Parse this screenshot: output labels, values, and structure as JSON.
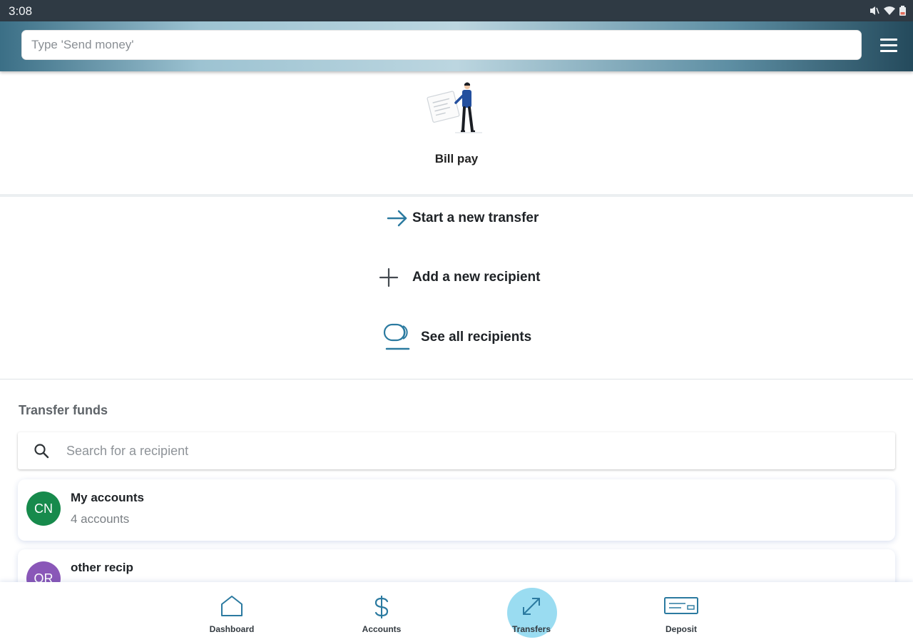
{
  "status_bar": {
    "time": "3:08"
  },
  "header": {
    "search_placeholder": "Type 'Send money'"
  },
  "bill_pay": {
    "label": "Bill pay"
  },
  "actions": {
    "start_transfer": "Start a new transfer",
    "add_recipient": "Add a new recipient",
    "see_all_recipients": "See all recipients"
  },
  "transfer_funds": {
    "title": "Transfer funds",
    "search_placeholder": "Search for a recipient",
    "recipients": [
      {
        "initials": "CN",
        "name": "My accounts",
        "subtitle": "4 accounts",
        "color": "#178a4c"
      },
      {
        "initials": "OR",
        "name": "other recip",
        "subtitle": "",
        "color": "#8a57b8"
      }
    ]
  },
  "bottom_nav": {
    "items": [
      {
        "label": "Dashboard",
        "icon": "home-icon"
      },
      {
        "label": "Accounts",
        "icon": "dollar-icon"
      },
      {
        "label": "Transfers",
        "icon": "transfer-arrows-icon",
        "active": true
      },
      {
        "label": "Deposit",
        "icon": "check-deposit-icon"
      }
    ]
  },
  "colors": {
    "accent": "#2b7aa0",
    "active_nav": "#8fd8ef",
    "header_dark": "#2f3a44"
  }
}
